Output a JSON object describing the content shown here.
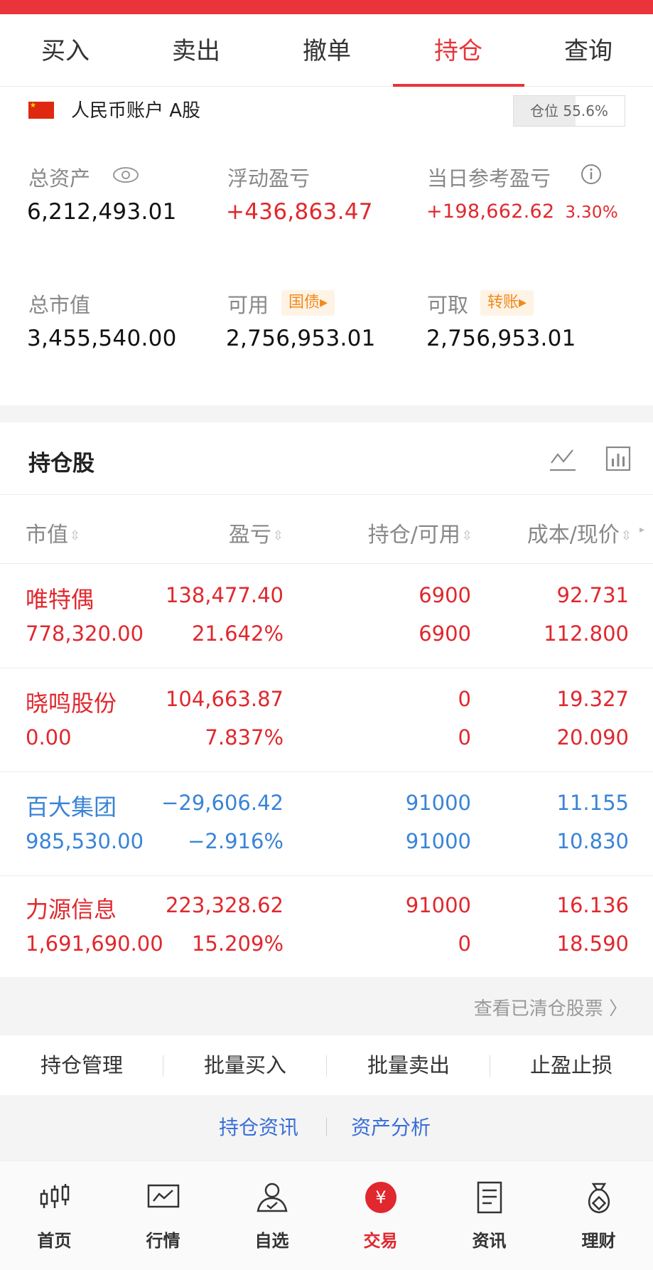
{
  "tabs": [
    {
      "label": "买入"
    },
    {
      "label": "卖出"
    },
    {
      "label": "撤单"
    },
    {
      "label": "持仓",
      "active": true
    },
    {
      "label": "查询"
    }
  ],
  "account": {
    "label": "人民币账户 A股",
    "position_text": "仓位 55.6%",
    "position_ratio": 0.556
  },
  "metrics": {
    "total_assets": {
      "label": "总资产",
      "value": "6,212,493.01"
    },
    "floating_pl": {
      "label": "浮动盈亏",
      "value": "+436,863.47"
    },
    "daily_pl": {
      "label": "当日参考盈亏",
      "value": "+198,662.62",
      "percent": "3.30%"
    },
    "market_value": {
      "label": "总市值",
      "value": "3,455,540.00"
    },
    "available": {
      "label": "可用",
      "tag": "国债▸",
      "value": "2,756,953.01"
    },
    "withdrawable": {
      "label": "可取",
      "tag": "转账▸",
      "value": "2,756,953.01"
    }
  },
  "holdings": {
    "title": "持仓股",
    "columns": [
      {
        "label": "市值"
      },
      {
        "label": "盈亏"
      },
      {
        "label": "持仓/可用"
      },
      {
        "label": "成本/现价"
      }
    ],
    "sort_glyph": "⇳",
    "more_glyph": "▸",
    "rows": [
      {
        "name": "唯特偶",
        "market_value": "778,320.00",
        "pl": "138,477.40",
        "pl_pct": "21.642%",
        "hold": "6900",
        "avail": "6900",
        "cost": "92.731",
        "price": "112.800",
        "color": "#e0282e"
      },
      {
        "name": "晓鸣股份",
        "market_value": "0.00",
        "pl": "104,663.87",
        "pl_pct": "7.837%",
        "hold": "0",
        "avail": "0",
        "cost": "19.327",
        "price": "20.090",
        "color": "#e0282e"
      },
      {
        "name": "百大集团",
        "market_value": "985,530.00",
        "pl": "−29,606.42",
        "pl_pct": "−2.916%",
        "hold": "91000",
        "avail": "91000",
        "cost": "11.155",
        "price": "10.830",
        "color": "#3a84d6"
      },
      {
        "name": "力源信息",
        "market_value": "1,691,690.00",
        "pl": "223,328.62",
        "pl_pct": "15.209%",
        "hold": "91000",
        "avail": "0",
        "cost": "16.136",
        "price": "18.590",
        "color": "#e0282e"
      }
    ]
  },
  "cleared_link": "查看已清仓股票 〉",
  "actions": [
    {
      "label": "持仓管理"
    },
    {
      "label": "批量买入"
    },
    {
      "label": "批量卖出"
    },
    {
      "label": "止盈止损"
    }
  ],
  "links": [
    {
      "label": "持仓资讯"
    },
    {
      "label": "资产分析"
    }
  ],
  "bottom_nav": [
    {
      "label": "首页",
      "icon": "candlestick-icon"
    },
    {
      "label": "行情",
      "icon": "chart-screen-icon"
    },
    {
      "label": "自选",
      "icon": "user-check-icon"
    },
    {
      "label": "交易",
      "icon": "yuan-circle-icon",
      "active": true,
      "glyph": "¥"
    },
    {
      "label": "资讯",
      "icon": "document-icon"
    },
    {
      "label": "理财",
      "icon": "money-bag-icon"
    }
  ],
  "colors": {
    "accent": "#e8343a",
    "up": "#e0282e",
    "down": "#3a84d6",
    "link": "#3a6fd6",
    "tag": "#f08a1c"
  }
}
